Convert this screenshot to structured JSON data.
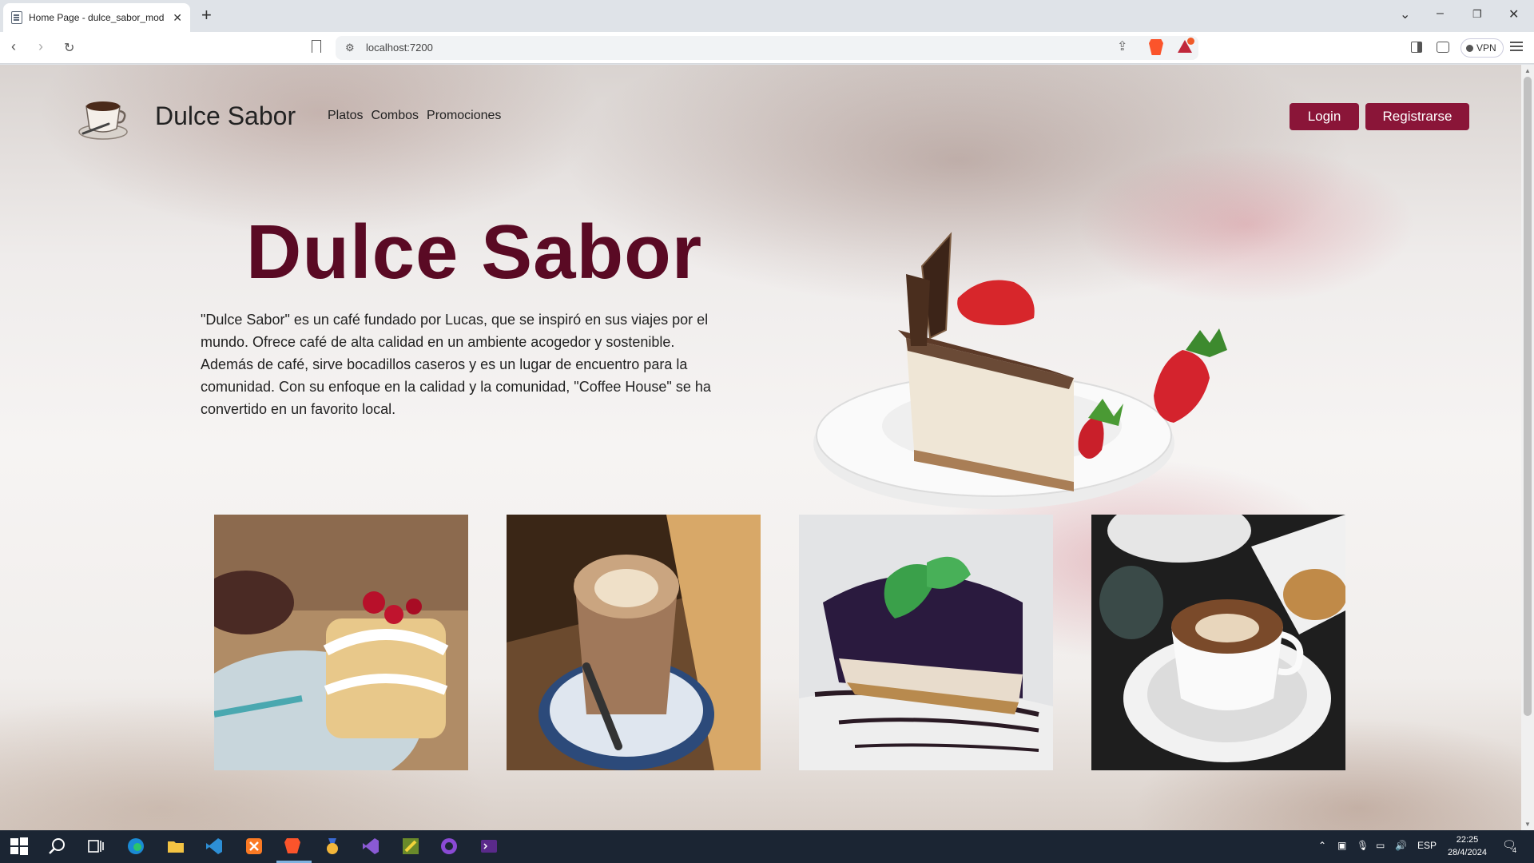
{
  "browser": {
    "tab_title": "Home Page - dulce_sabor_mod",
    "url": "localhost:7200",
    "vpn_label": "VPN"
  },
  "site": {
    "brand": "Dulce Sabor",
    "nav": [
      "Platos",
      "Combos",
      "Promociones"
    ],
    "login_label": "Login",
    "register_label": "Registrarse",
    "accent_color": "#8a1538",
    "title_color": "#5a0a24"
  },
  "hero": {
    "title": "Dulce Sabor",
    "description": "\"Dulce Sabor\" es un café fundado por Lucas, que se inspiró en sus viajes por el mundo. Ofrece café de alta calidad en un ambiente acogedor y sostenible. Además de café, sirve bocadillos caseros y es un lugar de encuentro para la comunidad. Con su enfoque en la calidad y la comunidad, \"Coffee House\" se ha convertido en un favorito local."
  },
  "taskbar": {
    "language": "ESP",
    "time": "22:25",
    "date": "28/4/2024",
    "notifications": "4"
  }
}
